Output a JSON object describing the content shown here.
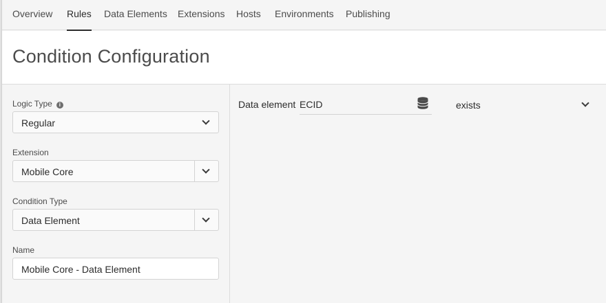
{
  "tabs": [
    {
      "label": "Overview"
    },
    {
      "label": "Rules",
      "active": true
    },
    {
      "label": "Data Elements"
    },
    {
      "label": "Extensions"
    },
    {
      "label": "Hosts"
    },
    {
      "label": "Environments"
    },
    {
      "label": "Publishing"
    }
  ],
  "header": {
    "title": "Condition Configuration"
  },
  "form": {
    "logic_type": {
      "label": "Logic Type",
      "value": "Regular",
      "icon": "info-icon"
    },
    "extension": {
      "label": "Extension",
      "value": "Mobile Core"
    },
    "condition_type": {
      "label": "Condition Type",
      "value": "Data Element"
    },
    "name": {
      "label": "Name",
      "value": "Mobile Core - Data Element"
    }
  },
  "condition": {
    "data_element_label": "Data element",
    "data_element_value": "ECID",
    "data_element_icon": "database-icon",
    "operator": "exists"
  },
  "colors": {
    "background": "#f5f5f5",
    "header_bg": "#ffffff",
    "text": "#2c2c2c",
    "border": "#d3d3d3"
  }
}
